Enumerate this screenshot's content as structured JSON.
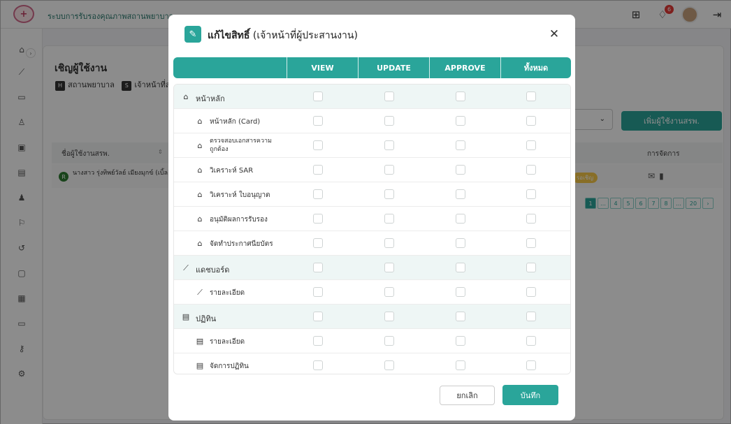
{
  "app": {
    "title": "ระบบการรับรองคุณภาพสถานพยาบาล",
    "logo_text": "+",
    "notification_count": "6"
  },
  "page": {
    "title": "เชิญผู้ใช้งาน",
    "tab_hospital": "สถานพยาบาล",
    "tab_staff": "เจ้าหน้าที่สถ",
    "add_button": "เพิ่มผู้ใช้งานสรพ.",
    "table": {
      "col_name": "ชื่อผู้ใช้งานสรพ.",
      "col_manage": "การจัดการ",
      "rows": [
        {
          "avatar": "R",
          "name": "นางสาว รุ่งทิพย์วัลย์ เมียงมุกข์ (เบิ้ล)",
          "status": "รอเชิญ"
        }
      ]
    },
    "pagination": [
      "1",
      "…",
      "4",
      "5",
      "6",
      "7",
      "8",
      "…",
      "20",
      "›"
    ]
  },
  "modal": {
    "title_bold": "แก้ไขสิทธิ์",
    "title_rest": " (เจ้าหน้าที่ผู้ประสานงาน)",
    "columns": [
      "VIEW",
      "UPDATE",
      "APPROVE",
      "ทั้งหมด"
    ],
    "rows": [
      {
        "label": "หน้าหลัก",
        "icon": "⌂",
        "group": true
      },
      {
        "label": "หน้าหลัก (Card)",
        "icon": "⌂",
        "group": false
      },
      {
        "label": "ตรวจสอบเอกสารความถูกต้อง",
        "icon": "⌂",
        "group": false,
        "multi": true
      },
      {
        "label": "วิเคราะห์ SAR",
        "icon": "⌂",
        "group": false
      },
      {
        "label": "วิเคราะห์ ใบอนุญาต",
        "icon": "⌂",
        "group": false
      },
      {
        "label": "อนุมัติผลการรับรอง",
        "icon": "⌂",
        "group": false
      },
      {
        "label": "จัดทำประกาศนียบัตร",
        "icon": "⌂",
        "group": false
      },
      {
        "label": "แดชบอร์ด",
        "icon": "⟋",
        "group": true
      },
      {
        "label": "รายละเอียด",
        "icon": "⟋",
        "group": false
      },
      {
        "label": "ปฏิทิน",
        "icon": "▤",
        "group": true
      },
      {
        "label": "รายละเอียด",
        "icon": "▤",
        "group": false
      },
      {
        "label": "จัดการปฏิทิน",
        "icon": "▤",
        "group": false
      }
    ],
    "cancel": "ยกเลิก",
    "save": "บันทึก"
  },
  "colors": {
    "accent": "#2aa59a",
    "group_row": "#eef6f5"
  }
}
